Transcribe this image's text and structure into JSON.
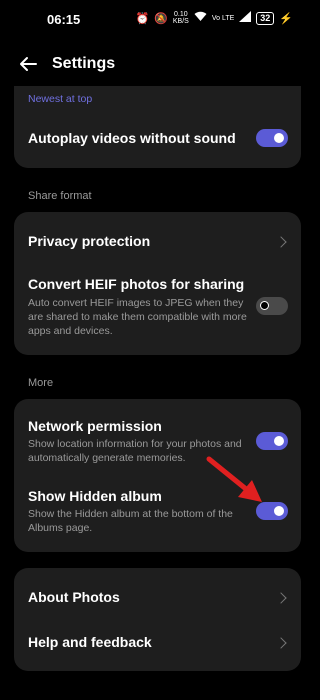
{
  "status": {
    "time": "06:15",
    "net_speed_value": "0.10",
    "net_speed_unit": "KB/S",
    "network_type": "Vo LTE",
    "battery": "32"
  },
  "app_bar": {
    "title": "Settings"
  },
  "sections": {
    "top_partial_label": "Newest at top",
    "autoplay_label": "Autoplay videos without sound",
    "autoplay_on": true,
    "share_format_label": "Share format",
    "privacy_label": "Privacy protection",
    "heif_title": "Convert HEIF photos for sharing",
    "heif_desc": "Auto convert HEIF images to JPEG when they are shared to make them compatible with more apps and devices.",
    "heif_on": false,
    "more_label": "More",
    "network_title": "Network permission",
    "network_desc": "Show location information for your photos and automatically generate memories.",
    "network_on": true,
    "hidden_title": "Show Hidden album",
    "hidden_desc": "Show the Hidden album at the bottom of the Albums page.",
    "hidden_on": true,
    "about_label": "About Photos",
    "help_label": "Help and feedback"
  },
  "colors": {
    "accent": "#5b5bd6",
    "annotation_arrow": "#e02020"
  }
}
